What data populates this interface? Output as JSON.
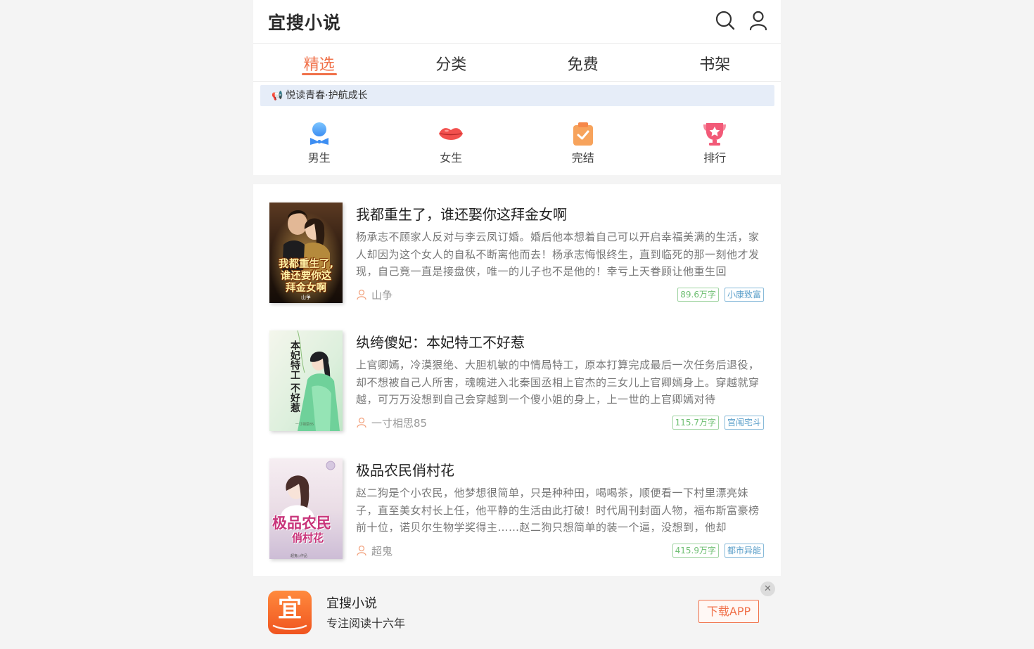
{
  "header": {
    "title": "宜搜小说",
    "search_icon": "search-icon",
    "user_icon": "user-icon"
  },
  "tabs": [
    {
      "label": "精选",
      "active": true
    },
    {
      "label": "分类",
      "active": false
    },
    {
      "label": "免费",
      "active": false
    },
    {
      "label": "书架",
      "active": false
    }
  ],
  "notice": {
    "icon": "speaker-icon",
    "text": "悦读青春·护航成长"
  },
  "categories": [
    {
      "label": "男生",
      "icon": "male-icon"
    },
    {
      "label": "女生",
      "icon": "lips-icon"
    },
    {
      "label": "完结",
      "icon": "checklist-icon"
    },
    {
      "label": "排行",
      "icon": "trophy-icon"
    }
  ],
  "books": [
    {
      "title": "我都重生了，谁还娶你这拜金女啊",
      "description": "杨承志不顾家人反对与李云凤订婚。婚后他本想着自己可以开启幸福美满的生活，家人却因为这个女人的自私不断离他而去！杨承志悔恨终生，直到临死的那一刻他才发现，自己竟一直是接盘侠，唯一的儿子也不是他的！幸亏上天眷顾让他重生回",
      "author": "山争",
      "words": "89.6万字",
      "genre": "小康致富",
      "cover_text": [
        "我都重生了,",
        "谁还要你这",
        "拜金女啊"
      ],
      "cover_author": "山争"
    },
    {
      "title": "纨绔傻妃：本妃特工不好惹",
      "description": "上官卿嫣，冷漠狠绝、大胆机敏的中情局特工，原本打算完成最后一次任务后退役，却不想被自己人所害，魂魄进入北秦国丞相上官杰的三女儿上官卿嫣身上。穿越就穿越，可万万没想到自己会穿越到一个傻小姐的身上，上一世的上官卿嫣对待",
      "author": "一寸相思85",
      "words": "115.7万字",
      "genre": "宫闱宅斗",
      "cover_text": [
        "本妃特工",
        "不好惹"
      ],
      "cover_author": "一寸相思85"
    },
    {
      "title": "极品农民俏村花",
      "description": "赵二狗是个小农民，他梦想很简单，只是种种田，喝喝茶，顺便看一下村里漂亮妹子，直至美女村长上任，他平静的生活由此打破！时代周刊封面人物，福布斯富豪榜前十位，诺贝尔生物学奖得主……赵二狗只想简单的装一个逼，没想到，他却",
      "author": "超鬼",
      "words": "415.9万字",
      "genre": "都市异能",
      "cover_text": [
        "极品农民",
        "俏村花"
      ],
      "cover_author": "超鬼"
    }
  ],
  "download_bar": {
    "app_icon": "yisou-app-icon",
    "app_icon_char": "宜",
    "name": "宜搜小说",
    "slogan": "专注阅读十六年",
    "button": "下载APP",
    "close": "✕"
  },
  "colors": {
    "accent": "#f0714a",
    "notice_bg": "#e6edf8",
    "words_tag": "#6fbf73",
    "genre_tag": "#5a9ec9"
  }
}
